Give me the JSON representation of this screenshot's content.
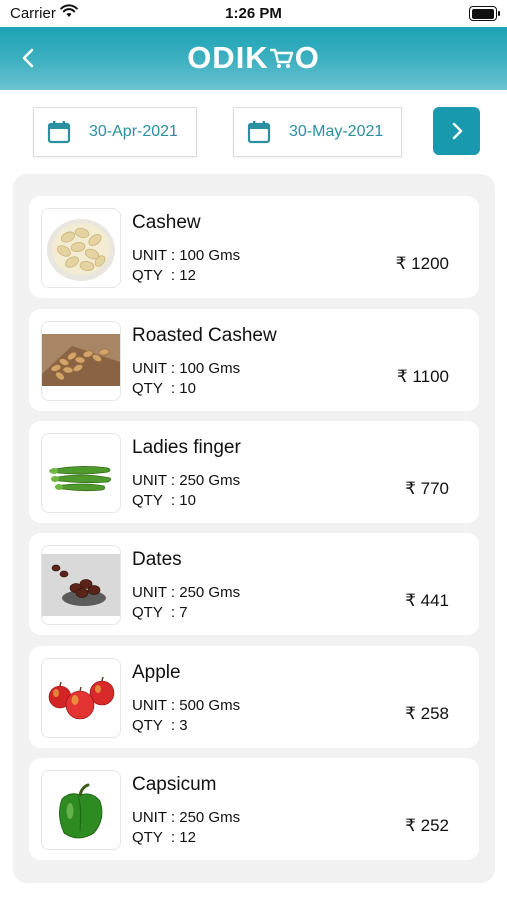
{
  "status_bar": {
    "carrier": "Carrier",
    "time": "1:26 PM"
  },
  "header": {
    "logo_text_left": "ODIK",
    "logo_text_right": "O",
    "back_icon": "chevron-left-icon"
  },
  "date_filter": {
    "from_date": "30-Apr-2021",
    "to_date": "30-May-2021",
    "next_icon": "chevron-right-icon"
  },
  "unit_label": "UNIT :",
  "qty_label": "QTY  :",
  "products": [
    {
      "name": "Cashew",
      "unit": "100 Gms",
      "qty": "12",
      "price": "₹ 1200",
      "image": "cashew-image"
    },
    {
      "name": "Roasted Cashew",
      "unit": "100 Gms",
      "qty": "10",
      "price": "₹ 1100",
      "image": "roasted-cashew-image"
    },
    {
      "name": "Ladies finger",
      "unit": "250 Gms",
      "qty": "10",
      "price": "₹ 770",
      "image": "ladies-finger-image"
    },
    {
      "name": "Dates",
      "unit": "250 Gms",
      "qty": "7",
      "price": "₹ 441",
      "image": "dates-image"
    },
    {
      "name": "Apple",
      "unit": "500 Gms",
      "qty": "3",
      "price": "₹ 258",
      "image": "apple-image"
    },
    {
      "name": "Capsicum",
      "unit": "250 Gms",
      "qty": "12",
      "price": "₹ 252",
      "image": "capsicum-image"
    }
  ],
  "colors": {
    "header": "#1ba3b4",
    "accent": "#1899ad",
    "date_text": "#2a8f9f",
    "panel": "#f1f1f1"
  }
}
